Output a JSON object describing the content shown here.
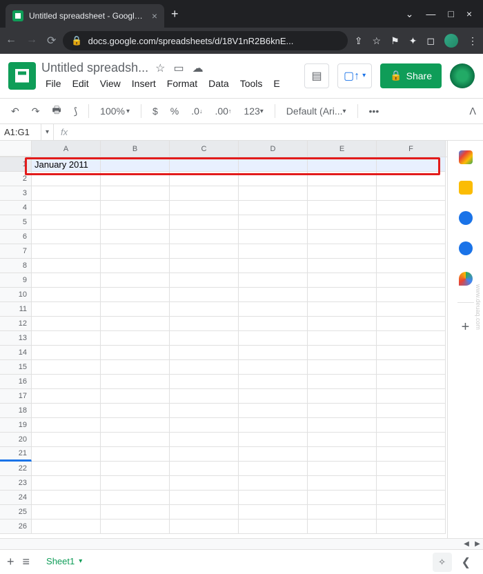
{
  "browser": {
    "tab_title": "Untitled spreadsheet - Google Sheets",
    "url": "docs.google.com/spreadsheets/d/18V1nR2B6knE..."
  },
  "doc": {
    "title": "Untitled spreadsh...",
    "menus": [
      "File",
      "Edit",
      "View",
      "Insert",
      "Format",
      "Data",
      "Tools",
      "E"
    ],
    "share_label": "Share"
  },
  "toolbar": {
    "zoom": "100%",
    "currency": "$",
    "percent": "%",
    "dec_dec": ".0",
    "inc_dec": ".00",
    "num_fmt": "123",
    "font": "Default (Ari...",
    "more": "•••"
  },
  "formula": {
    "name_box": "A1:G1",
    "fx": "fx"
  },
  "grid": {
    "columns": [
      "A",
      "B",
      "C",
      "D",
      "E",
      "F"
    ],
    "rows": 26,
    "cell_a1": "January 2011"
  },
  "sheet_tabs": {
    "active": "Sheet1"
  },
  "watermark": "www.deuaq.com"
}
